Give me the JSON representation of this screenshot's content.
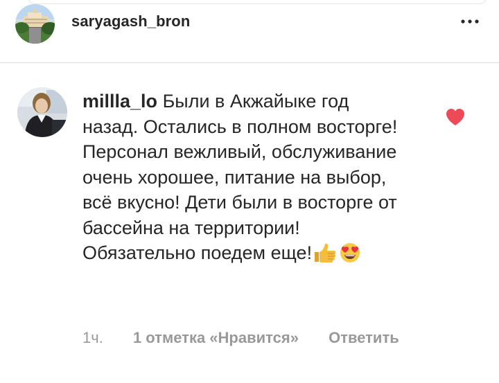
{
  "post_header": {
    "username": "saryagash_bron",
    "more_icon": "more-horizontal-icon"
  },
  "comment": {
    "username": "millla_lo",
    "text": "Были в Акжайыке год назад. Остались в полном восторге! Персонал вежливый, обслуживание очень хорошее, питание на выбор, всё вкусно! Дети были в восторге от бассейна на территории! Обязательно поедем еще!",
    "emojis": [
      "thumbs-up-emoji",
      "heart-eyes-emoji"
    ],
    "time": "1ч.",
    "likes_label": "1 отметка «Нравится»",
    "reply_label": "Ответить",
    "liked": true
  },
  "colors": {
    "text": "#262626",
    "secondary": "#999999",
    "like_red": "#ed4956",
    "divider": "#dbdbdb"
  }
}
